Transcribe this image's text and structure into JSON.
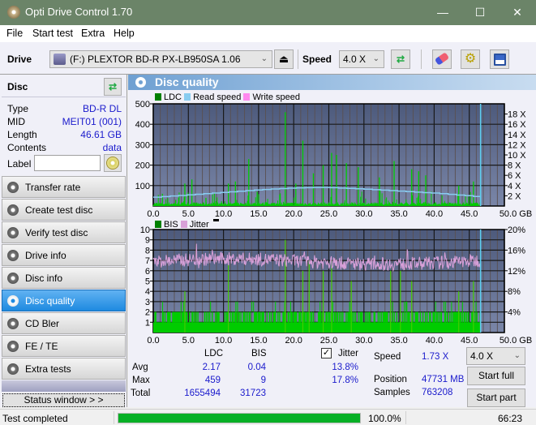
{
  "window": {
    "title": "Opti Drive Control 1.70",
    "minimize": "—",
    "maximize": "☐",
    "close": "✕"
  },
  "menu": [
    {
      "label": "File"
    },
    {
      "label": "Start test"
    },
    {
      "label": "Extra"
    },
    {
      "label": "Help"
    }
  ],
  "toolbar": {
    "drive_label": "Drive",
    "drive_value": "(F:)  PLEXTOR BD-R  PX-LB950SA 1.06",
    "speed_label": "Speed",
    "speed_value": "4.0 X",
    "icons": [
      "eject-icon",
      "refresh-icon",
      "erase-icon",
      "settings-icon",
      "save-icon"
    ]
  },
  "disc": {
    "header": "Disc",
    "fields": [
      {
        "key": "Type",
        "value": "BD-R DL"
      },
      {
        "key": "MID",
        "value": "MEIT01 (001)"
      },
      {
        "key": "Length",
        "value": "46.61 GB"
      },
      {
        "key": "Contents",
        "value": "data"
      }
    ],
    "label_key": "Label",
    "label_value": ""
  },
  "nav": [
    {
      "label": "Transfer rate",
      "active": false
    },
    {
      "label": "Create test disc",
      "active": false
    },
    {
      "label": "Verify test disc",
      "active": false
    },
    {
      "label": "Drive info",
      "active": false
    },
    {
      "label": "Disc info",
      "active": false
    },
    {
      "label": "Disc quality",
      "active": true
    },
    {
      "label": "CD Bler",
      "active": false
    },
    {
      "label": "FE / TE",
      "active": false
    },
    {
      "label": "Extra tests",
      "active": false
    }
  ],
  "status_window_button": "Status window > >",
  "panel": {
    "title": "Disc quality"
  },
  "chart_data": [
    {
      "type": "bar",
      "title": "LDC / Read speed",
      "legend": [
        {
          "name": "LDC",
          "color": "#008000"
        },
        {
          "name": "Read speed",
          "color": "#88ccf0"
        },
        {
          "name": "Write speed",
          "color": "#ff88ee"
        }
      ],
      "legend_position": "top-left",
      "x_ticks": [
        "0.0",
        "5.0",
        "10.0",
        "15.0",
        "20.0",
        "25.0",
        "30.0",
        "35.0",
        "40.0",
        "45.0",
        "50.0 GB"
      ],
      "xlim": [
        0,
        50
      ],
      "y_left_ticks": [
        "500",
        "400",
        "300",
        "200",
        "100"
      ],
      "ylim_left": [
        0,
        500
      ],
      "y_right_ticks": [
        "18 X",
        "16 X",
        "14 X",
        "12 X",
        "10 X",
        "8 X",
        "6 X",
        "4 X",
        "2 X"
      ],
      "ylim_right": [
        0,
        20
      ],
      "data_end_gb": 46.61,
      "read_speed": {
        "x": [
          0,
          5,
          10,
          15,
          20,
          23.5,
          25,
          30,
          35,
          40,
          45,
          46.6
        ],
        "y": [
          1.73,
          2.2,
          2.7,
          3.2,
          3.55,
          3.65,
          3.6,
          3.3,
          2.9,
          2.5,
          1.95,
          1.73
        ]
      },
      "ldc_spikes": {
        "x": [
          1.3,
          3.2,
          4.5,
          5.5,
          7.5,
          10.7,
          11.7,
          13.6,
          14.8,
          18.8,
          20.3,
          21.3,
          22.8,
          24.2,
          25.4,
          26.1,
          27.5,
          29.2,
          32.2,
          34.3,
          36.8,
          37.8,
          38.8,
          43.5,
          45.6
        ],
        "y": [
          60,
          30,
          110,
          130,
          40,
          110,
          120,
          230,
          70,
          459,
          110,
          320,
          160,
          200,
          260,
          250,
          210,
          190,
          140,
          220,
          180,
          170,
          150,
          100,
          120
        ]
      },
      "ldc_baseline": 15
    },
    {
      "type": "bar",
      "title": "BIS / Jitter",
      "legend": [
        {
          "name": "BIS",
          "color": "#008000"
        },
        {
          "name": "Jitter",
          "color": "#d8a0d8"
        }
      ],
      "legend_position": "top-left",
      "x_ticks": [
        "0.0",
        "5.0",
        "10.0",
        "15.0",
        "20.0",
        "25.0",
        "30.0",
        "35.0",
        "40.0",
        "45.0",
        "50.0 GB"
      ],
      "xlim": [
        0,
        50
      ],
      "y_left_ticks": [
        "10",
        "9",
        "8",
        "7",
        "6",
        "5",
        "4",
        "3",
        "2",
        "1"
      ],
      "ylim_left": [
        0,
        10
      ],
      "y_right_ticks": [
        "20%",
        "16%",
        "12%",
        "8%",
        "4%"
      ],
      "ylim_right": [
        0,
        20
      ],
      "data_end_gb": 46.61,
      "jitter_avg_pct": 13.8,
      "jitter_range_pct": [
        12.5,
        17.8
      ],
      "bis_spikes": {
        "x": [
          4.5,
          10.7,
          18.8,
          21.3,
          22.2,
          24.2,
          25.4,
          28.2,
          33.8,
          35.2,
          36.8,
          43.5,
          45.6
        ],
        "y": [
          4,
          7,
          9,
          6,
          7,
          6,
          7,
          5,
          6,
          6,
          5,
          4,
          5
        ]
      },
      "bis_base_levels": [
        1,
        2
      ]
    }
  ],
  "stats": {
    "columns": [
      "LDC",
      "BIS"
    ],
    "rows": [
      {
        "label": "Avg",
        "ldc": "2.17",
        "bis": "0.04",
        "jitter": "13.8%"
      },
      {
        "label": "Max",
        "ldc": "459",
        "bis": "9",
        "jitter": "17.8%"
      },
      {
        "label": "Total",
        "ldc": "1655494",
        "bis": "31723",
        "jitter": ""
      }
    ],
    "jitter_label": "Jitter",
    "jitter_checked": true,
    "speed_label": "Speed",
    "speed_value": "1.73 X",
    "position_label": "Position",
    "position_value": "47731 MB",
    "samples_label": "Samples",
    "samples_value": "763208",
    "speed_select": "4.0 X",
    "start_full": "Start full",
    "start_part": "Start part"
  },
  "statusbar": {
    "message": "Test completed",
    "progress_pct": 100,
    "progress_text": "100.0%",
    "elapsed": "66:23"
  }
}
